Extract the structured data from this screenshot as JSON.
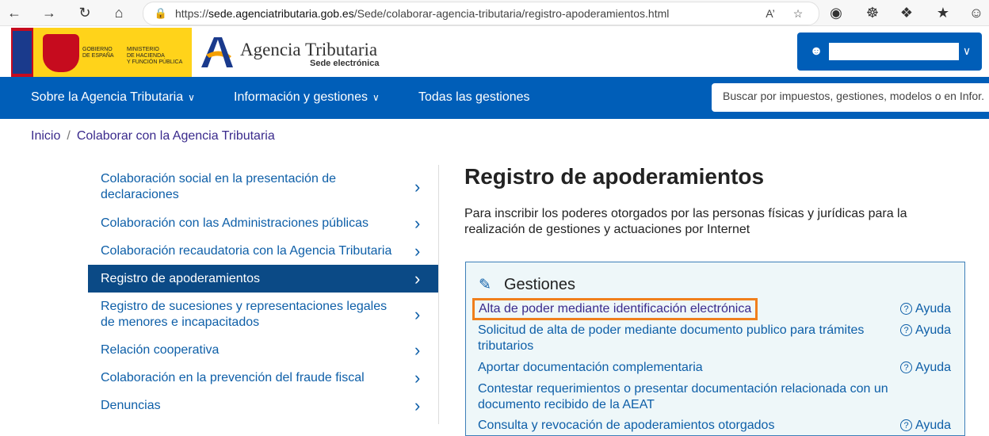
{
  "browser": {
    "url_prefix": "https://",
    "url_host": "sede.agenciatributaria.gob.es",
    "url_path": "/Sede/colaborar-agencia-tributaria/registro-apoderamientos.html",
    "icons": [
      "back-icon",
      "forward-icon",
      "refresh-icon",
      "home-icon",
      "lock-icon",
      "read-aloud-icon",
      "favorite-add-icon",
      "tracking-icon",
      "extension-puzzle-icon",
      "favorites-icon",
      "profile-icon"
    ]
  },
  "header": {
    "gob_line1": "Gobierno",
    "gob_line2": "de España",
    "ministry_line1": "Ministerio",
    "ministry_line2": "de Hacienda",
    "ministry_line3": "y Función Pública",
    "brand_name": "Agencia Tributaria",
    "brand_sub": "Sede electrónica",
    "brand_color": "#005eb8"
  },
  "nav": {
    "items": [
      {
        "label": "Sobre la Agencia Tributaria",
        "has_dropdown": true
      },
      {
        "label": "Información y gestiones",
        "has_dropdown": true
      },
      {
        "label": "Todas las gestiones",
        "has_dropdown": false
      }
    ],
    "search_placeholder": "Buscar por impuestos, gestiones, modelos o en Infor..."
  },
  "breadcrumb": [
    "Inicio",
    "Colaborar con la Agencia Tributaria"
  ],
  "sidebar": {
    "items": [
      {
        "label": "Colaboración social en la presentación de declaraciones",
        "active": false
      },
      {
        "label": "Colaboración con las Administraciones públicas",
        "active": false
      },
      {
        "label": "Colaboración recaudatoria con la Agencia Tributaria",
        "active": false
      },
      {
        "label": "Registro de apoderamientos",
        "active": true
      },
      {
        "label": "Registro de sucesiones y representaciones legales de menores e incapacitados",
        "active": false
      },
      {
        "label": "Relación cooperativa",
        "active": false
      },
      {
        "label": "Colaboración en la prevención del fraude fiscal",
        "active": false
      },
      {
        "label": "Denuncias",
        "active": false
      }
    ]
  },
  "main": {
    "title": "Registro de apoderamientos",
    "intro": "Para inscribir los poderes otorgados por las personas físicas y jurídicas para la realización de gestiones y actuaciones por Internet",
    "gestiones": {
      "title": "Gestiones",
      "help_label": "Ayuda",
      "items": [
        {
          "label": "Alta de poder mediante identificación electrónica",
          "help": true,
          "highlighted": true
        },
        {
          "label": "Solicitud de alta de poder mediante documento publico para trámites tributarios",
          "help": true,
          "highlighted": false
        },
        {
          "label": "Aportar documentación complementaria",
          "help": true,
          "highlighted": false
        },
        {
          "label": "Contestar requerimientos o presentar documentación relacionada con un documento recibido de la AEAT",
          "help": false,
          "highlighted": false
        },
        {
          "label": "Consulta y revocación de apoderamientos otorgados",
          "help": true,
          "highlighted": false
        }
      ]
    }
  },
  "colors": {
    "primary": "#005eb8",
    "active_sidebar": "#0b4a86",
    "link": "#0e5fa8",
    "highlight_border": "#f07f1d"
  }
}
